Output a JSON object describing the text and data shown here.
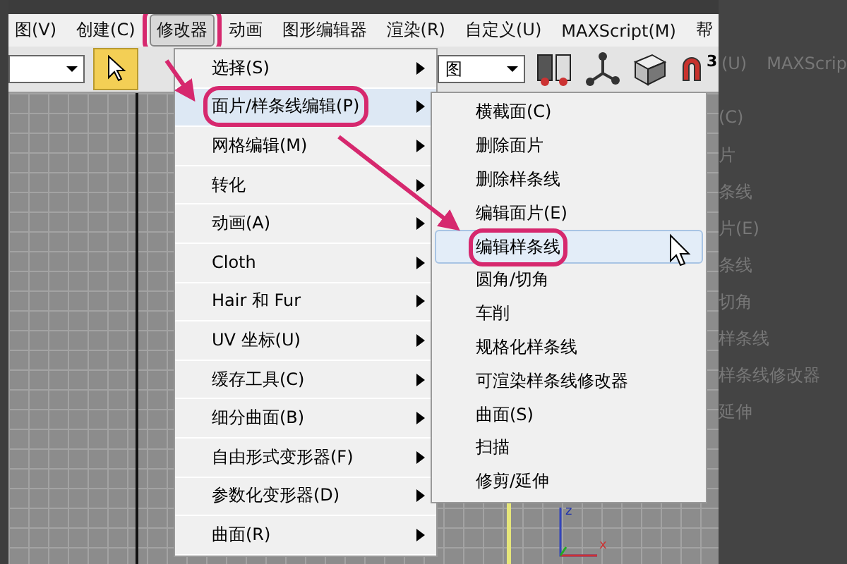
{
  "menubar": {
    "items": [
      {
        "label": "图(V)",
        "selected": false
      },
      {
        "label": "创建(C)",
        "selected": false
      },
      {
        "label": "修改器",
        "selected": true
      },
      {
        "label": "动画",
        "selected": false
      },
      {
        "label": "图形编辑器",
        "selected": false
      },
      {
        "label": "渲染(R)",
        "selected": false
      },
      {
        "label": "自定义(U)",
        "selected": false
      },
      {
        "label": "MAXScript(M)",
        "selected": false
      },
      {
        "label": "帮",
        "selected": false
      }
    ]
  },
  "toolbar": {
    "view_dropdown": "图",
    "snap_count": "3"
  },
  "modifiers_menu": {
    "items": [
      {
        "label": "选择(S)",
        "selected": false
      },
      {
        "label": "面片/样条线编辑(P)",
        "selected": true
      },
      {
        "label": "网格编辑(M)",
        "selected": false
      },
      {
        "label": "转化",
        "selected": false
      },
      {
        "label": "动画(A)",
        "selected": false
      },
      {
        "label": "Cloth",
        "selected": false
      },
      {
        "label": "Hair 和 Fur",
        "selected": false
      },
      {
        "label": "UV 坐标(U)",
        "selected": false
      },
      {
        "label": "缓存工具(C)",
        "selected": false
      },
      {
        "label": "细分曲面(B)",
        "selected": false
      },
      {
        "label": "自由形式变形器(F)",
        "selected": false
      },
      {
        "label": "参数化变形器(D)",
        "selected": false
      },
      {
        "label": "曲面(R)",
        "selected": false
      }
    ]
  },
  "submenu": {
    "items": [
      {
        "label": "横截面(C)",
        "selected": false
      },
      {
        "label": "删除面片",
        "selected": false
      },
      {
        "label": "删除样条线",
        "selected": false
      },
      {
        "label": "编辑面片(E)",
        "selected": false
      },
      {
        "label": "编辑样条线",
        "selected": true
      },
      {
        "label": "圆角/切角",
        "selected": false
      },
      {
        "label": "车削",
        "selected": false
      },
      {
        "label": "规格化样条线",
        "selected": false
      },
      {
        "label": "可渲染样条线修改器",
        "selected": false
      },
      {
        "label": "曲面(S)",
        "selected": false
      },
      {
        "label": "扫描",
        "selected": false
      },
      {
        "label": "修剪/延伸",
        "selected": false
      }
    ]
  },
  "viewport": {
    "axis_labels": [
      "z",
      "x"
    ]
  },
  "background_copy": {
    "menubar_texts": [
      "(U)",
      "MAXScrip"
    ],
    "menu_texts": [
      "(C)",
      "片",
      "条线",
      "片(E)",
      "条线",
      "切角",
      "样条线",
      "样条线修改器",
      "延伸"
    ]
  }
}
